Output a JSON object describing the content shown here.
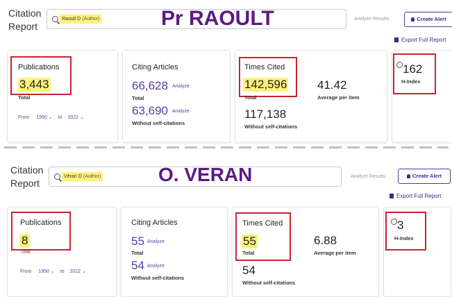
{
  "top": {
    "report_title_1": "Citation",
    "report_title_2": "Report",
    "search_chip_name": "Raoult D",
    "search_chip_role": "(Author)",
    "overlay_name": "Pr RAOULT",
    "analyze_results": "Analyze Results",
    "create_alert": "Create Alert",
    "export_full_report": "Export Full Report",
    "publications": {
      "label": "Publications",
      "value": "3,443",
      "sub": "Total"
    },
    "from_label": "From",
    "from_year": "1950",
    "to_label": "to",
    "to_year": "2022",
    "citing": {
      "label": "Citing Articles",
      "value1": "66,628",
      "analyze": "Analyze",
      "sub1": "Total",
      "value2": "63,690",
      "sub2": "Without self-citations"
    },
    "times_cited": {
      "label": "Times Cited",
      "value1": "142,596",
      "sub1": "Total",
      "avg": "41.42",
      "avg_label": "Average per item",
      "value2": "117,138",
      "sub2": "Without self-citations"
    },
    "h_index": {
      "value": "162",
      "label": "H-Index"
    }
  },
  "bottom": {
    "report_title_1": "Citation",
    "report_title_2": "Report",
    "search_chip_name": "Véran O",
    "search_chip_role": "(Author)",
    "overlay_name": "O. VERAN",
    "analyze_results": "Analyze Results",
    "create_alert": "Create Alert",
    "export_full_report": "Export Full Report",
    "publications": {
      "label": "Publications",
      "value": "8",
      "sub": "Total"
    },
    "from_label": "From",
    "from_year": "1950",
    "to_label": "to",
    "to_year": "2022",
    "citing": {
      "label": "Citing Articles",
      "value1": "55",
      "analyze": "Analyze",
      "sub1": "Total",
      "value2": "54",
      "sub2": "Without self-citations"
    },
    "times_cited": {
      "label": "Times Cited",
      "value1": "55",
      "sub1": "Total",
      "avg": "6.88",
      "avg_label": "Average per item",
      "value2": "54",
      "sub2": "Without self-citations"
    },
    "h_index": {
      "value": "3",
      "label": "H-Index"
    }
  },
  "colors": {
    "highlight": "#fff27a",
    "red_box": "#c8232c",
    "overlay_purple": "#5b1a83",
    "accent_purple": "#5a3aa8"
  }
}
